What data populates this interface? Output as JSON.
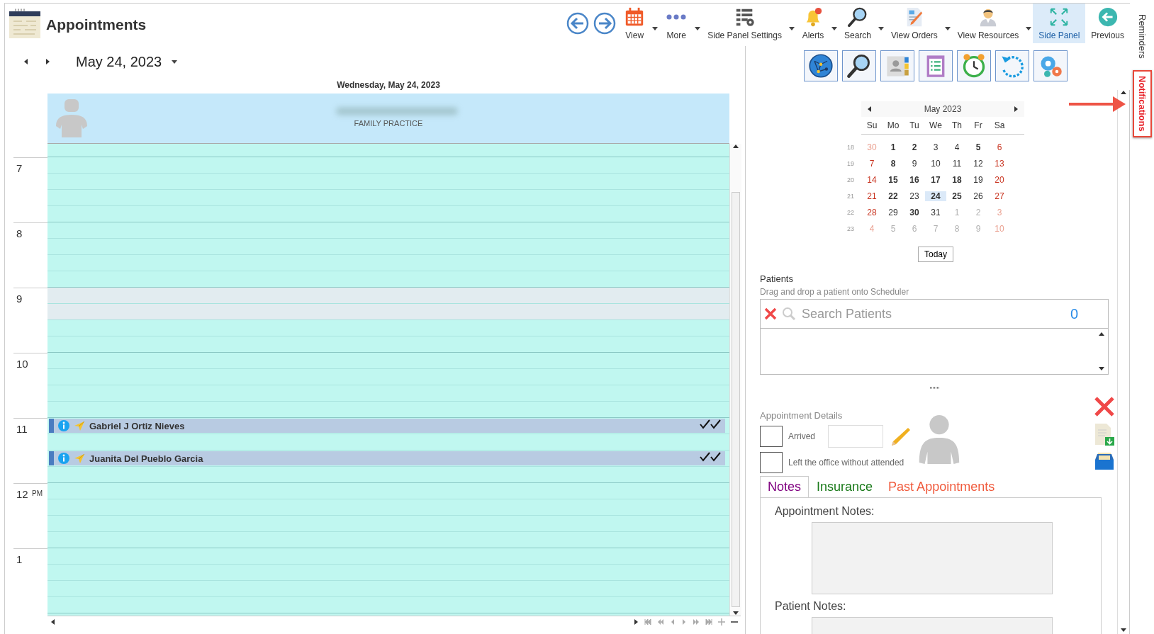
{
  "window": {
    "title": "Appointments"
  },
  "toolbar": [
    {
      "kind": "view",
      "label": "View",
      "dropdown": true,
      "on": false
    },
    {
      "kind": "more",
      "label": "More",
      "dropdown": true,
      "on": false
    },
    {
      "kind": "settings",
      "label": "Side Panel Settings",
      "dropdown": true,
      "on": false
    },
    {
      "kind": "alerts",
      "label": "Alerts",
      "dropdown": true,
      "on": false
    },
    {
      "kind": "search",
      "label": "Search",
      "dropdown": true,
      "on": false
    },
    {
      "kind": "orders",
      "label": "View Orders",
      "dropdown": true,
      "on": false
    },
    {
      "kind": "resources",
      "label": "View Resources",
      "dropdown": true,
      "on": false
    },
    {
      "kind": "sidepanel",
      "label": "Side Panel",
      "dropdown": false,
      "on": true
    },
    {
      "kind": "previous",
      "label": "Previous",
      "dropdown": false,
      "on": false
    }
  ],
  "side_tabs": [
    {
      "label": "Reminders",
      "highlighted": false
    },
    {
      "label": "Notifications",
      "highlighted": true
    }
  ],
  "scheduler": {
    "date": "May 24, 2023",
    "day_title": "Wednesday, May 24, 2023",
    "resource": {
      "department": "FAMILY PRACTICE"
    },
    "hours": [
      {
        "label": "7",
        "slots": [
          {
            "shaded": false
          },
          {
            "shaded": false
          },
          {
            "shaded": false
          },
          {
            "shaded": false
          }
        ]
      },
      {
        "label": "8",
        "slots": [
          {
            "shaded": false
          },
          {
            "shaded": false
          },
          {
            "shaded": false
          },
          {
            "shaded": false
          }
        ]
      },
      {
        "label": "9",
        "slots": [
          {
            "shaded": true
          },
          {
            "shaded": true
          },
          {
            "shaded": false
          },
          {
            "shaded": false
          }
        ]
      },
      {
        "label": "10",
        "slots": [
          {
            "shaded": false
          },
          {
            "shaded": false
          },
          {
            "shaded": false
          },
          {
            "shaded": false
          }
        ]
      },
      {
        "label": "11",
        "slots": [
          {
            "shaded": false,
            "appointment": {
              "name": "Gabriel J Ortiz Nieves"
            }
          },
          {
            "shaded": false
          },
          {
            "shaded": false,
            "appointment": {
              "name": "Juanita Del Pueblo Garcia"
            }
          },
          {
            "shaded": false
          }
        ]
      },
      {
        "label": "12",
        "suffix": "PM",
        "slots": [
          {
            "shaded": false
          },
          {
            "shaded": false
          },
          {
            "shaded": false
          },
          {
            "shaded": false
          }
        ]
      },
      {
        "label": "1",
        "slots": [
          {
            "shaded": false
          },
          {
            "shaded": false
          },
          {
            "shaded": false
          },
          {
            "shaded": false
          }
        ]
      }
    ]
  },
  "calendar": {
    "title": "May 2023",
    "weekdays": [
      "Su",
      "Mo",
      "Tu",
      "We",
      "Th",
      "Fr",
      "Sa"
    ],
    "today_button": "Today",
    "weeks": [
      {
        "week": "18",
        "days": [
          {
            "day": "30",
            "other_month": true,
            "bold": false,
            "selected": false
          },
          {
            "day": "1",
            "other_month": false,
            "bold": true,
            "selected": false
          },
          {
            "day": "2",
            "other_month": false,
            "bold": true,
            "selected": false
          },
          {
            "day": "3",
            "other_month": false,
            "bold": false,
            "selected": false
          },
          {
            "day": "4",
            "other_month": false,
            "bold": false,
            "selected": false
          },
          {
            "day": "5",
            "other_month": false,
            "bold": true,
            "selected": false
          },
          {
            "day": "6",
            "other_month": false,
            "bold": false,
            "selected": false
          }
        ]
      },
      {
        "week": "19",
        "days": [
          {
            "day": "7",
            "other_month": false,
            "bold": false,
            "selected": false
          },
          {
            "day": "8",
            "other_month": false,
            "bold": true,
            "selected": false
          },
          {
            "day": "9",
            "other_month": false,
            "bold": false,
            "selected": false
          },
          {
            "day": "10",
            "other_month": false,
            "bold": false,
            "selected": false
          },
          {
            "day": "11",
            "other_month": false,
            "bold": false,
            "selected": false
          },
          {
            "day": "12",
            "other_month": false,
            "bold": false,
            "selected": false
          },
          {
            "day": "13",
            "other_month": false,
            "bold": false,
            "selected": false
          }
        ]
      },
      {
        "week": "20",
        "days": [
          {
            "day": "14",
            "other_month": false,
            "bold": false,
            "selected": false
          },
          {
            "day": "15",
            "other_month": false,
            "bold": true,
            "selected": false
          },
          {
            "day": "16",
            "other_month": false,
            "bold": true,
            "selected": false
          },
          {
            "day": "17",
            "other_month": false,
            "bold": true,
            "selected": false
          },
          {
            "day": "18",
            "other_month": false,
            "bold": true,
            "selected": false
          },
          {
            "day": "19",
            "other_month": false,
            "bold": false,
            "selected": false
          },
          {
            "day": "20",
            "other_month": false,
            "bold": false,
            "selected": false
          }
        ]
      },
      {
        "week": "21",
        "days": [
          {
            "day": "21",
            "other_month": false,
            "bold": false,
            "selected": false
          },
          {
            "day": "22",
            "other_month": false,
            "bold": true,
            "selected": false
          },
          {
            "day": "23",
            "other_month": false,
            "bold": false,
            "selected": false
          },
          {
            "day": "24",
            "other_month": false,
            "bold": true,
            "selected": true
          },
          {
            "day": "25",
            "other_month": false,
            "bold": true,
            "selected": false
          },
          {
            "day": "26",
            "other_month": false,
            "bold": false,
            "selected": false
          },
          {
            "day": "27",
            "other_month": false,
            "bold": false,
            "selected": false
          }
        ]
      },
      {
        "week": "22",
        "days": [
          {
            "day": "28",
            "other_month": false,
            "bold": false,
            "selected": false
          },
          {
            "day": "29",
            "other_month": false,
            "bold": false,
            "selected": false
          },
          {
            "day": "30",
            "other_month": false,
            "bold": true,
            "selected": false
          },
          {
            "day": "31",
            "other_month": false,
            "bold": false,
            "selected": false
          },
          {
            "day": "1",
            "other_month": true,
            "bold": false,
            "selected": false
          },
          {
            "day": "2",
            "other_month": true,
            "bold": false,
            "selected": false
          },
          {
            "day": "3",
            "other_month": true,
            "bold": false,
            "selected": false
          }
        ]
      },
      {
        "week": "23",
        "days": [
          {
            "day": "4",
            "other_month": true,
            "bold": false,
            "selected": false
          },
          {
            "day": "5",
            "other_month": true,
            "bold": false,
            "selected": false
          },
          {
            "day": "6",
            "other_month": true,
            "bold": false,
            "selected": false
          },
          {
            "day": "7",
            "other_month": true,
            "bold": false,
            "selected": false
          },
          {
            "day": "8",
            "other_month": true,
            "bold": false,
            "selected": false
          },
          {
            "day": "9",
            "other_month": true,
            "bold": false,
            "selected": false
          },
          {
            "day": "10",
            "other_month": true,
            "bold": false,
            "selected": false
          }
        ]
      }
    ]
  },
  "patients": {
    "title": "Patients",
    "hint": "Drag and drop a patient onto Scheduler",
    "search": {
      "placeholder": "Search Patients"
    },
    "count": "0"
  },
  "appointment_details": {
    "title": "Appointment Details",
    "checks": [
      {
        "label": "Arrived",
        "checked": false,
        "with_field": true
      },
      {
        "label": "Left the office without attended",
        "checked": false,
        "with_field": false
      }
    ],
    "tabs": [
      {
        "label": "Notes",
        "selected": true,
        "color": "#800080"
      },
      {
        "label": "Insurance",
        "selected": false,
        "color": "#1a7a1a"
      },
      {
        "label": "Past Appointments",
        "selected": false,
        "color": "#f05a3c"
      }
    ],
    "notes": [
      {
        "label": "Appointment Notes:"
      },
      {
        "label": "Patient Notes:"
      }
    ]
  }
}
